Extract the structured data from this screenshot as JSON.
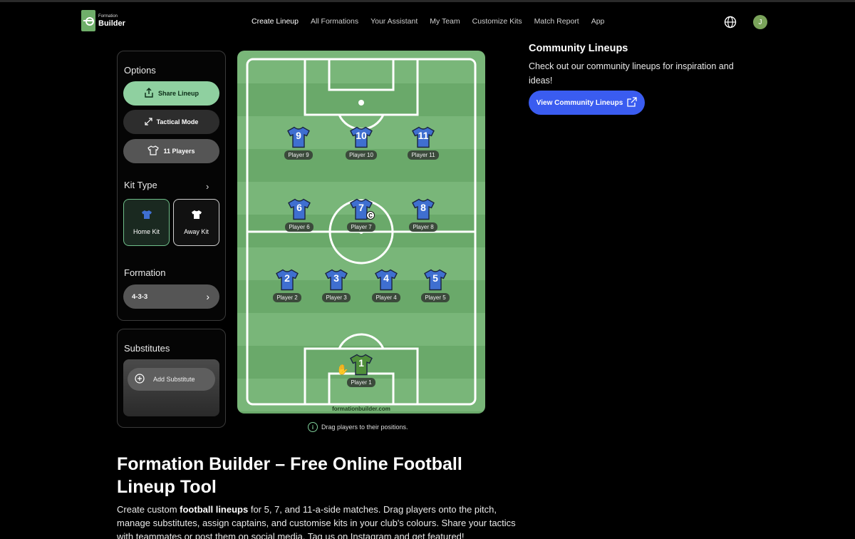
{
  "header": {
    "logo_small": "Formation",
    "logo_big": "Builder",
    "nav": [
      "Create Lineup",
      "All Formations",
      "Your Assistant",
      "My Team",
      "Customize Kits",
      "Match Report",
      "App"
    ],
    "avatar_initial": "J"
  },
  "options": {
    "title": "Options",
    "share": "Share Lineup",
    "tactical": "Tactical Mode",
    "players": "11 Players",
    "kit_type_title": "Kit Type",
    "home_kit": "Home Kit",
    "away_kit": "Away Kit",
    "formation_title": "Formation",
    "formation_value": "4-3-3"
  },
  "substitutes": {
    "title": "Substitutes",
    "add": "Add Substitute"
  },
  "pitch": {
    "credit": "formationbuilder.com",
    "captain_mark": "C",
    "players": [
      {
        "number": "9",
        "name": "Player 9"
      },
      {
        "number": "10",
        "name": "Player 10"
      },
      {
        "number": "11",
        "name": "Player 11"
      },
      {
        "number": "6",
        "name": "Player 6"
      },
      {
        "number": "7",
        "name": "Player 7"
      },
      {
        "number": "8",
        "name": "Player 8"
      },
      {
        "number": "2",
        "name": "Player 2"
      },
      {
        "number": "3",
        "name": "Player 3"
      },
      {
        "number": "4",
        "name": "Player 4"
      },
      {
        "number": "5",
        "name": "Player 5"
      },
      {
        "number": "1",
        "name": "Player 1"
      }
    ],
    "colors": {
      "home": "#3f6fd0",
      "goalkeeper": "#4f8f3a"
    }
  },
  "hint": "Drag players to their positions.",
  "community": {
    "title": "Community Lineups",
    "desc": "Check out our community lineups for inspiration and ideas!",
    "button": "View Community Lineups"
  },
  "intro": {
    "heading": "Formation Builder – Free Online Football Lineup Tool",
    "p_pre": "Create custom ",
    "p_bold": "football lineups",
    "p_post": " for 5, 7, and 11-a-side matches. Drag players onto the pitch, manage substitutes, assign captains, and customise kits in your club's colours. Share your tactics with teammates or post them on social media. Tag us on Instagram and get featured!"
  }
}
